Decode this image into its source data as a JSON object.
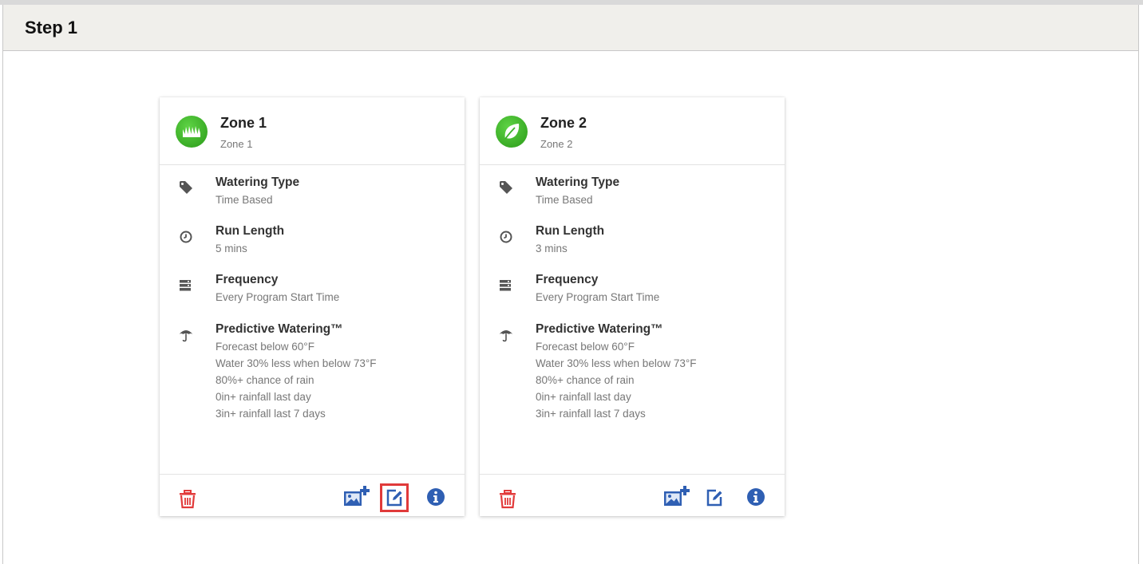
{
  "step": {
    "title": "Step 1"
  },
  "zones": [
    {
      "name": "Zone 1",
      "subtitle": "Zone 1",
      "avatar_icon": "grass-icon",
      "watering_type": {
        "label": "Watering Type",
        "value": "Time Based"
      },
      "run_length": {
        "label": "Run Length",
        "value": "5 mins"
      },
      "frequency": {
        "label": "Frequency",
        "value": "Every Program Start Time"
      },
      "predictive": {
        "label": "Predictive Watering™",
        "lines": [
          "Forecast below 60°F",
          "Water 30% less when below 73°F",
          "80%+ chance of rain",
          "0in+ rainfall last day",
          "3in+ rainfall last 7 days"
        ]
      }
    },
    {
      "name": "Zone 2",
      "subtitle": "Zone 2",
      "avatar_icon": "leaf-icon",
      "watering_type": {
        "label": "Watering Type",
        "value": "Time Based"
      },
      "run_length": {
        "label": "Run Length",
        "value": "3 mins"
      },
      "frequency": {
        "label": "Frequency",
        "value": "Every Program Start Time"
      },
      "predictive": {
        "label": "Predictive Watering™",
        "lines": [
          "Forecast below 60°F",
          "Water 30% less when below 73°F",
          "80%+ chance of rain",
          "0in+ rainfall last day",
          "3in+ rainfall last 7 days"
        ]
      }
    }
  ],
  "colors": {
    "accent_green": "#3bb32a",
    "action_blue": "#2f5fb3",
    "delete_red": "#e23b3b",
    "highlight_red": "#e03a3a"
  }
}
